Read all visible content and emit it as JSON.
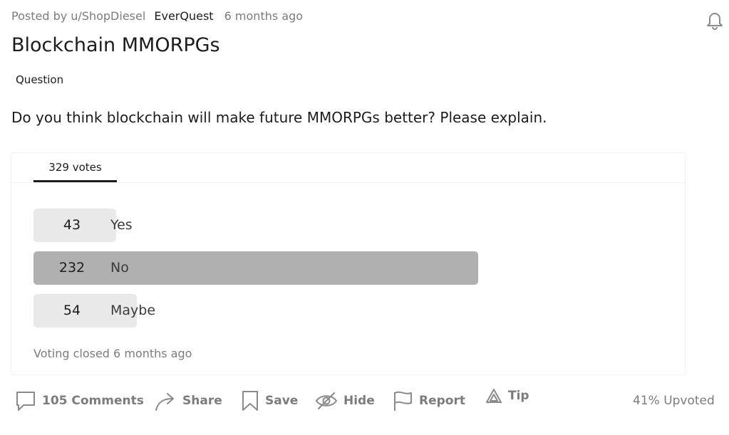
{
  "post": {
    "author": "Posted by u/ShopDiesel",
    "subreddit": "EverQuest",
    "time": "6 months ago",
    "title": "Blockchain MMORPGs",
    "flair": "Question",
    "body": "Do you think blockchain will make future MMORPGs better? Please explain."
  },
  "poll": {
    "votes_tab": "329 votes",
    "total_votes": 329,
    "options": [
      {
        "count": "43",
        "label": "Yes",
        "votes": 43
      },
      {
        "count": "232",
        "label": "No",
        "votes": 232,
        "winner": true
      },
      {
        "count": "54",
        "label": "Maybe",
        "votes": 54
      }
    ],
    "status": "Voting closed 6 months ago",
    "colors": {
      "bar": "#e9e9e9",
      "winner_bar": "#b0b0b0"
    }
  },
  "actions": {
    "comments": "105 Comments",
    "share": "Share",
    "save": "Save",
    "hide": "Hide",
    "report": "Report",
    "tip": "Tip",
    "upvoted": "41% Upvoted"
  },
  "icons": [
    "bell-icon",
    "comment-icon",
    "share-icon",
    "bookmark-icon",
    "hide-eye-icon",
    "flag-icon",
    "tip-icon"
  ]
}
